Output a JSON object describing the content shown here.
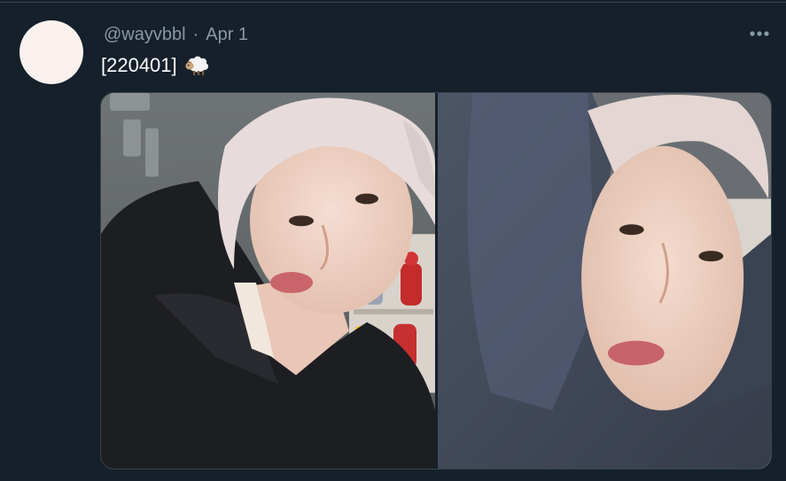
{
  "tweet": {
    "handle": "@wayvbbl",
    "separator": "·",
    "date": "Apr 1",
    "text": "[220401]",
    "emoji_icon": "sheep-icon",
    "more_icon": "more-options-icon"
  },
  "media": {
    "photos": [
      {
        "name": "selfie-black-hoodie"
      },
      {
        "name": "selfie-gray-hood-up"
      }
    ]
  },
  "colors": {
    "background": "#15202b",
    "secondary_text": "#8899a6",
    "border": "#38444d",
    "avatar": "#fbf1ee"
  }
}
